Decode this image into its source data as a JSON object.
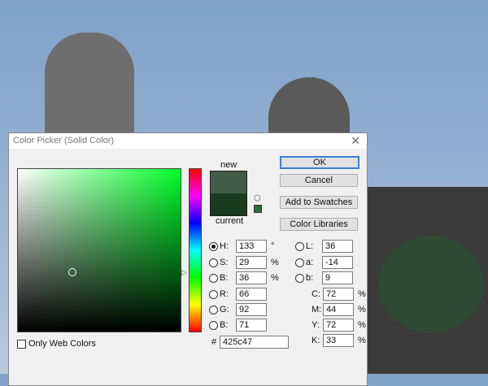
{
  "dialog": {
    "title": "Color Picker (Solid Color)",
    "close": "✕"
  },
  "preview": {
    "new_label": "new",
    "current_label": "current",
    "new_color": "#425c47",
    "current_color": "#1a3b1e"
  },
  "buttons": {
    "ok": "OK",
    "cancel": "Cancel",
    "add_swatches": "Add to Swatches",
    "color_libraries": "Color Libraries"
  },
  "hsb": [
    {
      "label": "H:",
      "value": "133",
      "unit": "°"
    },
    {
      "label": "S:",
      "value": "29",
      "unit": "%"
    },
    {
      "label": "B:",
      "value": "36",
      "unit": "%"
    }
  ],
  "rgb": [
    {
      "label": "R:",
      "value": "66"
    },
    {
      "label": "G:",
      "value": "92"
    },
    {
      "label": "B:",
      "value": "71"
    }
  ],
  "lab": [
    {
      "label": "L:",
      "value": "36"
    },
    {
      "label": "a:",
      "value": "-14"
    },
    {
      "label": "b:",
      "value": "9"
    }
  ],
  "cmyk": [
    {
      "label": "C:",
      "value": "72",
      "unit": "%"
    },
    {
      "label": "M:",
      "value": "44",
      "unit": "%"
    },
    {
      "label": "Y:",
      "value": "72",
      "unit": "%"
    },
    {
      "label": "K:",
      "value": "33",
      "unit": "%"
    }
  ],
  "hex": {
    "label": "#",
    "value": "425c47"
  },
  "web_colors": {
    "label": "Only Web Colors",
    "checked": false
  }
}
